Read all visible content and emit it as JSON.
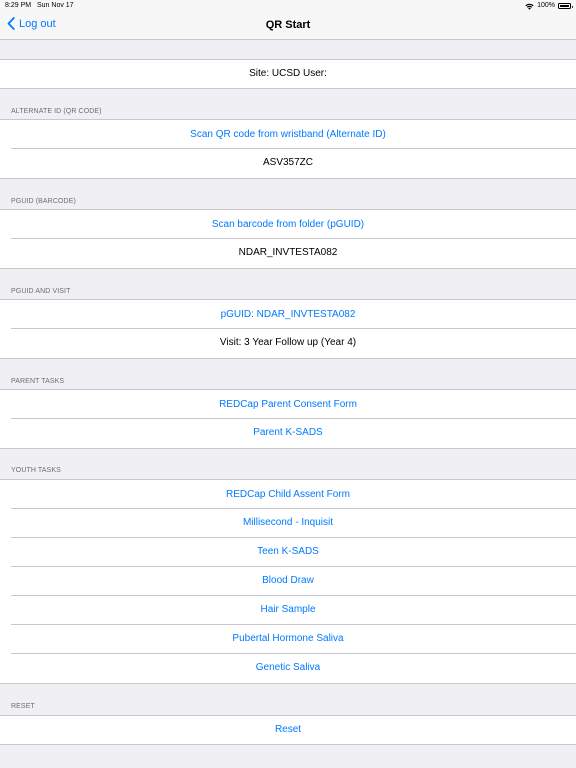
{
  "status_bar": {
    "time": "8:29 PM",
    "date": "Sun Nov 17",
    "battery": "100%"
  },
  "nav": {
    "back_label": "Log out",
    "title": "QR Start"
  },
  "site_info": "Site: UCSD User:",
  "sections": {
    "alternate_id": {
      "header": "ALTERNATE ID (QR CODE)",
      "scan_label": "Scan QR code from wristband (Alternate ID)",
      "value": "ASV357ZC"
    },
    "pguid": {
      "header": "PGUID (BARCODE)",
      "scan_label": "Scan barcode from folder (pGUID)",
      "value": "NDAR_INVTESTA082"
    },
    "pguid_visit": {
      "header": "PGUID AND VISIT",
      "pguid_label": "pGUID: NDAR_INVTESTA082",
      "visit_label": "Visit: 3 Year Follow up (Year 4)"
    },
    "parent_tasks": {
      "header": "PARENT TASKS",
      "items": [
        "REDCap Parent Consent Form",
        "Parent K-SADS"
      ]
    },
    "youth_tasks": {
      "header": "YOUTH TASKS",
      "items": [
        "REDCap Child Assent Form",
        "Millisecond - Inquisit",
        "Teen K-SADS",
        "Blood Draw",
        "Hair Sample",
        "Pubertal Hormone Saliva",
        "Genetic Saliva"
      ]
    },
    "reset": {
      "header": "RESET",
      "label": "Reset"
    }
  }
}
